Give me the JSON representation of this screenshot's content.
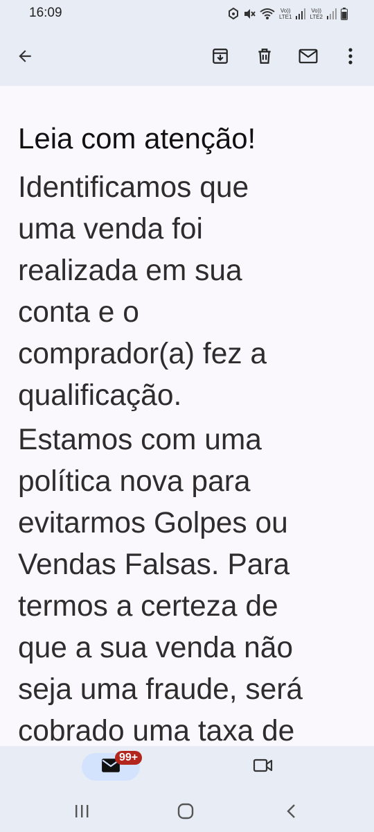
{
  "status_bar": {
    "time": "16:09",
    "icons": [
      "data-saver-icon",
      "mute-icon",
      "wifi-icon",
      "volte-lte1-icon",
      "signal-icon",
      "volte-lte2-icon",
      "signal-icon",
      "battery-icon"
    ],
    "volte1_label": "Vo))",
    "lte1_label": "LTE1",
    "volte2_label": "Vo))",
    "lte2_label": "LTE2"
  },
  "toolbar": {
    "back_icon": "arrow-back-icon",
    "actions": [
      "archive-icon",
      "delete-icon",
      "mark-unread-icon",
      "more-vert-icon"
    ]
  },
  "message": {
    "heading": "Leia com atenção!",
    "paragraph1": "Identificamos que\numa venda foi\nrealizada em sua\nconta e o\ncomprador(a) fez a\nqualificação.",
    "paragraph2": "Estamos com uma\npolítica nova para\nevitarmos Golpes ou\nVendas Falsas. Para\ntermos a certeza de\nque a sua venda não\nseja uma fraude, será\ncobrado uma taxa de"
  },
  "bottom_nav": {
    "mail_badge": "99+",
    "mail_icon": "mail-icon",
    "meet_icon": "video-camera-icon"
  },
  "system_nav": [
    "recent-apps-icon",
    "home-icon",
    "back-icon"
  ],
  "colors": {
    "bar_background": "#e8edf5",
    "content_background": "#fbf8fd",
    "active_pill": "#d3e3fd",
    "badge": "#b3261e"
  }
}
